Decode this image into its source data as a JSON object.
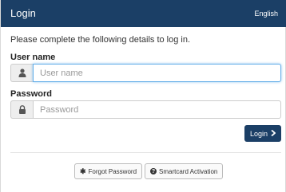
{
  "header": {
    "title": "Login",
    "language": "English"
  },
  "intro_text": "Please complete the following details to log in.",
  "username": {
    "label": "User name",
    "placeholder": "User name",
    "value": "",
    "icon": "user-icon"
  },
  "password": {
    "label": "Password",
    "placeholder": "Password",
    "value": "",
    "icon": "lock-icon"
  },
  "login_button": {
    "label": "Login",
    "icon": "chevron-right-icon"
  },
  "forgot_password": {
    "label": "Forgot Password",
    "icon": "asterisk-icon"
  },
  "smartcard": {
    "label": "Smartcard Activation",
    "icon": "question-circle-icon"
  },
  "colors": {
    "header_bg": "#1b3f66",
    "button_bg": "#1b3f66",
    "focus_border": "#66afe9"
  }
}
